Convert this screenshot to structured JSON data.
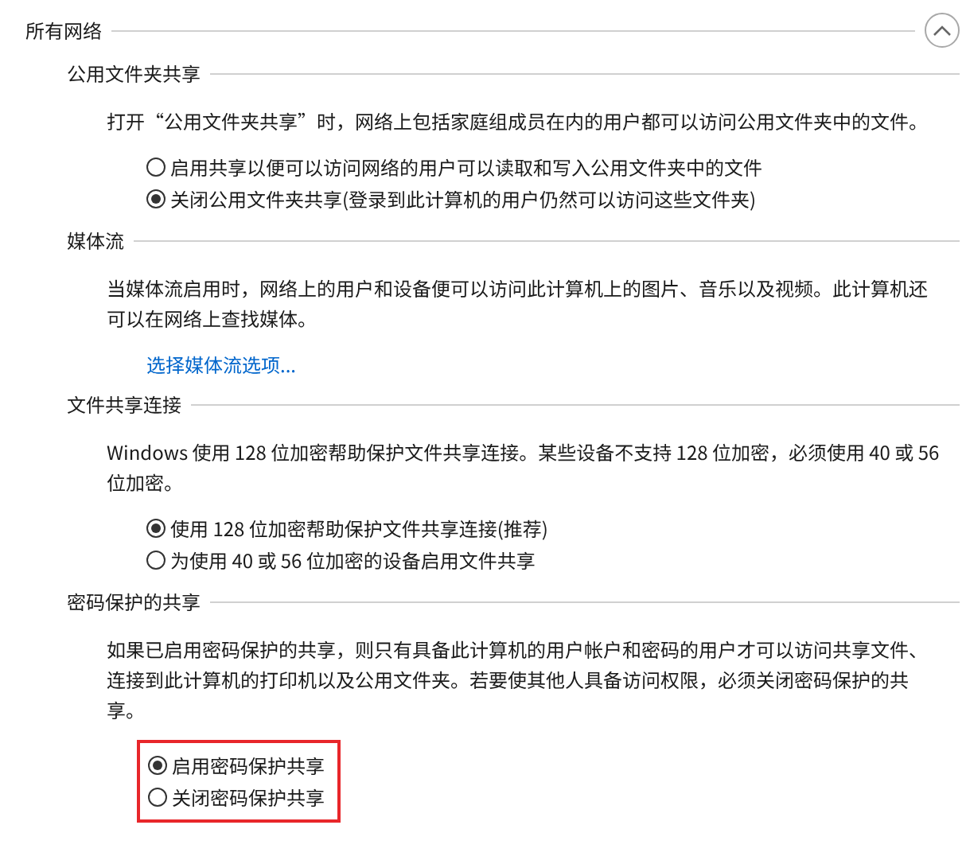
{
  "group": {
    "title": "所有网络",
    "expanded": true
  },
  "sections": [
    {
      "title": "公用文件夹共享",
      "description": "打开“公用文件夹共享”时，网络上包括家庭组成员在内的用户都可以访问公用文件夹中的文件。",
      "highlighted": false,
      "options": [
        {
          "label": "启用共享以便可以访问网络的用户可以读取和写入公用文件夹中的文件",
          "selected": false
        },
        {
          "label": "关闭公用文件夹共享(登录到此计算机的用户仍然可以访问这些文件夹)",
          "selected": true
        }
      ]
    },
    {
      "title": "媒体流",
      "description": "当媒体流启用时，网络上的用户和设备便可以访问此计算机上的图片、音乐以及视频。此计算机还可以在网络上查找媒体。",
      "link": "选择媒体流选项..."
    },
    {
      "title": "文件共享连接",
      "description": "Windows 使用 128 位加密帮助保护文件共享连接。某些设备不支持 128 位加密，必须使用 40 或 56 位加密。",
      "highlighted": false,
      "options": [
        {
          "label": "使用 128 位加密帮助保护文件共享连接(推荐)",
          "selected": true
        },
        {
          "label": "为使用 40 或 56 位加密的设备启用文件共享",
          "selected": false
        }
      ]
    },
    {
      "title": "密码保护的共享",
      "description": "如果已启用密码保护的共享，则只有具备此计算机的用户帐户和密码的用户才可以访问共享文件、连接到此计算机的打印机以及公用文件夹。若要使其他人具备访问权限，必须关闭密码保护的共享。",
      "highlighted": true,
      "options": [
        {
          "label": "启用密码保护共享",
          "selected": true
        },
        {
          "label": "关闭密码保护共享",
          "selected": false
        }
      ]
    }
  ]
}
